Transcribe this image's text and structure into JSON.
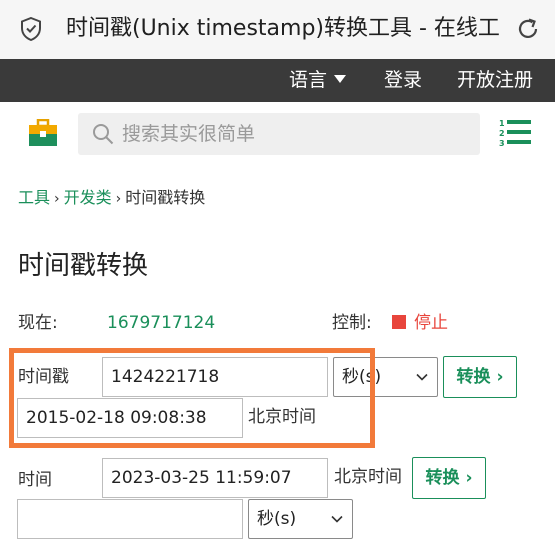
{
  "browser": {
    "page_title": "时间戳(Unix timestamp)转换工具 - 在线工"
  },
  "topnav": {
    "language": "语言",
    "login": "登录",
    "register": "开放注册"
  },
  "search": {
    "placeholder": "搜索其实很简单"
  },
  "breadcrumb": {
    "items": [
      "工具",
      "开发类",
      "时间戳转换"
    ],
    "separator": "›"
  },
  "page": {
    "title": "时间戳转换"
  },
  "now": {
    "label": "现在:",
    "value": "1679717124",
    "control_label": "控制:",
    "stop_label": "停止"
  },
  "timestamp_to_date": {
    "label": "时间戳",
    "input_value": "1424221718",
    "unit_selected": "秒(s)",
    "convert_label": "转换 ›",
    "output_value": "2015-02-18 09:08:38",
    "timezone_label": "北京时间"
  },
  "date_to_timestamp": {
    "label": "时间",
    "input_value": "2023-03-25 11:59:07",
    "timezone_label": "北京时间",
    "convert_label": "转换 ›",
    "output_value": "",
    "unit_selected": "秒(s)"
  },
  "colors": {
    "accent_green": "#1a8f5a",
    "stop_red": "#e8453c",
    "highlight_orange": "#f27a3a",
    "nav_dark": "#3a3a3a"
  },
  "icons": [
    "shield-icon",
    "reload-icon",
    "caret-down-icon",
    "toolbox-icon",
    "search-icon",
    "numbered-list-icon",
    "chevron-down-icon"
  ]
}
